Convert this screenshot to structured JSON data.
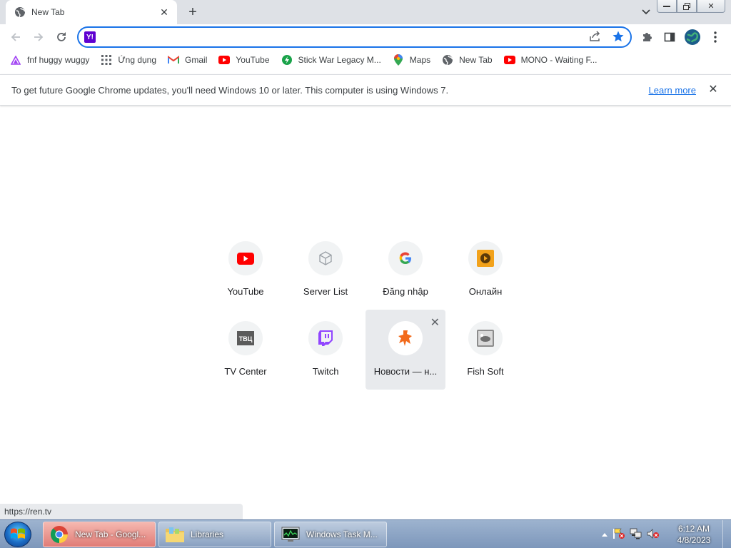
{
  "tab": {
    "title": "New Tab",
    "favicon": "globe-icon"
  },
  "omnibox": {
    "value": "",
    "engine_badge": "Y!"
  },
  "bookmarks": [
    {
      "label": "fnf huggy wuggy",
      "icon": "triangle-icon"
    },
    {
      "label": "Ứng dụng",
      "icon": "apps-grid-icon"
    },
    {
      "label": "Gmail",
      "icon": "gmail-icon"
    },
    {
      "label": "YouTube",
      "icon": "youtube-icon"
    },
    {
      "label": "Stick War Legacy M...",
      "icon": "game-icon"
    },
    {
      "label": "Maps",
      "icon": "maps-pin-icon"
    },
    {
      "label": "New Tab",
      "icon": "globe-icon"
    },
    {
      "label": "MONO - Waiting F...",
      "icon": "youtube-icon"
    }
  ],
  "infobar": {
    "message": "To get future Google Chrome updates, you'll need Windows 10 or later. This computer is using Windows 7.",
    "link": "Learn more"
  },
  "shortcuts": [
    {
      "label": "YouTube",
      "icon": "youtube-icon"
    },
    {
      "label": "Server List",
      "icon": "cube-icon"
    },
    {
      "label": "Đăng nhập",
      "icon": "google-icon"
    },
    {
      "label": "Онлайн",
      "icon": "play-icon"
    },
    {
      "label": "TV Center",
      "icon": "tvc-icon"
    },
    {
      "label": "Twitch",
      "icon": "twitch-icon"
    },
    {
      "label": "Новости — н...",
      "icon": "ren-icon"
    },
    {
      "label": "Fish Soft",
      "icon": "fish-icon"
    }
  ],
  "status_url": "https://ren.tv",
  "taskbar": {
    "items": [
      {
        "label": "New Tab - Googl...",
        "icon": "chrome-icon"
      },
      {
        "label": "Libraries",
        "icon": "folder-icon"
      },
      {
        "label": "Windows Task M...",
        "icon": "task-manager-icon"
      }
    ],
    "time": "6:12 AM",
    "date": "4/8/2023"
  },
  "colors": {
    "accent": "#1a73e8",
    "youtube_red": "#ff0000",
    "twitch_purple": "#9146ff",
    "ren_orange": "#f26a1b"
  }
}
